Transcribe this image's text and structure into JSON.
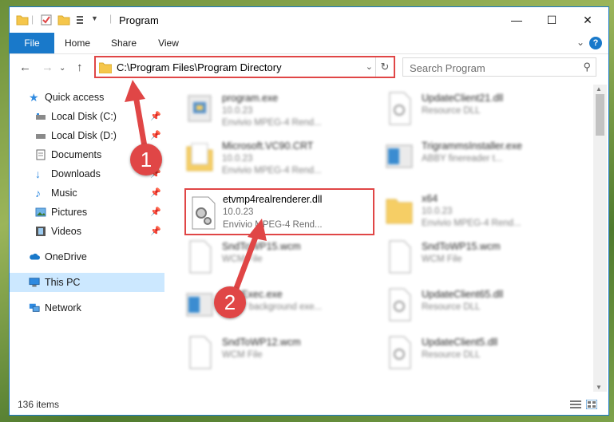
{
  "window": {
    "title": "Program",
    "controls": {
      "minimize": "—",
      "maximize": "☐",
      "close": "✕"
    }
  },
  "ribbon": {
    "tabs": [
      "File",
      "Home",
      "Share",
      "View"
    ],
    "help": "?"
  },
  "navigation": {
    "address_path": "C:\\Program Files\\Program Directory",
    "search_placeholder": "Search Program"
  },
  "sidebar": {
    "items": [
      {
        "label": "Quick access",
        "icon": "star-icon",
        "pinned": false
      },
      {
        "label": "Local Disk (C:)",
        "icon": "drive-icon",
        "pinned": true
      },
      {
        "label": "Local Disk (D:)",
        "icon": "drive-icon",
        "pinned": true
      },
      {
        "label": "Documents",
        "icon": "documents-icon",
        "pinned": true
      },
      {
        "label": "Downloads",
        "icon": "downloads-icon",
        "pinned": true
      },
      {
        "label": "Music",
        "icon": "music-icon",
        "pinned": true
      },
      {
        "label": "Pictures",
        "icon": "pictures-icon",
        "pinned": true
      },
      {
        "label": "Videos",
        "icon": "videos-icon",
        "pinned": true
      },
      {
        "label": "OneDrive",
        "icon": "cloud-icon",
        "pinned": false
      },
      {
        "label": "This PC",
        "icon": "pc-icon",
        "pinned": false,
        "selected": true
      },
      {
        "label": "Network",
        "icon": "network-icon",
        "pinned": false
      }
    ]
  },
  "files": [
    {
      "name": "program.exe",
      "line2": "10.0.23",
      "line3": "Envivio MPEG-4 Rend...",
      "icon": "exe-icon"
    },
    {
      "name": "UpdateClient21.dll",
      "line2": "Resource DLL",
      "line3": "",
      "icon": "dll-icon"
    },
    {
      "name": "Microsoft.VC90.CRT",
      "line2": "10.0.23",
      "line3": "Envivio MPEG-4 Rend...",
      "icon": "folder-icon"
    },
    {
      "name": "TrigrammsInstaller.exe",
      "line2": "ABBY finereader t...",
      "line3": "",
      "icon": "exe-icon"
    },
    {
      "name": "etvmp4realrenderer.dll",
      "line2": "10.0.23",
      "line3": "Envivio MPEG-4 Rend...",
      "icon": "dll-gear-icon",
      "highlighted": true
    },
    {
      "name": "x64",
      "line2": "10.0.23",
      "line3": "Envivio MPEG-4 Rend...",
      "icon": "folder-icon"
    },
    {
      "name": "SndToWP15.wcm",
      "line2": "WCM File",
      "line3": "",
      "icon": "file-icon"
    },
    {
      "name": "SndToWP15.wcm",
      "line2": "WCM File",
      "line3": "",
      "icon": "file-icon"
    },
    {
      "name": "FineExec.exe",
      "line2": "ABBY background exe...",
      "line3": "",
      "icon": "exe-icon"
    },
    {
      "name": "UpdateClient65.dll",
      "line2": "Resource DLL",
      "line3": "",
      "icon": "dll-icon"
    },
    {
      "name": "SndToWP12.wcm",
      "line2": "WCM File",
      "line3": "",
      "icon": "file-icon"
    },
    {
      "name": "UpdateClient5.dll",
      "line2": "Resource DLL",
      "line3": "",
      "icon": "dll-icon"
    }
  ],
  "status": {
    "item_count": "136 items"
  },
  "annotations": {
    "marker1": "1",
    "marker2": "2"
  },
  "colors": {
    "accent": "#1979ca",
    "highlight": "#e04646",
    "selected_bg": "#cce8ff"
  }
}
